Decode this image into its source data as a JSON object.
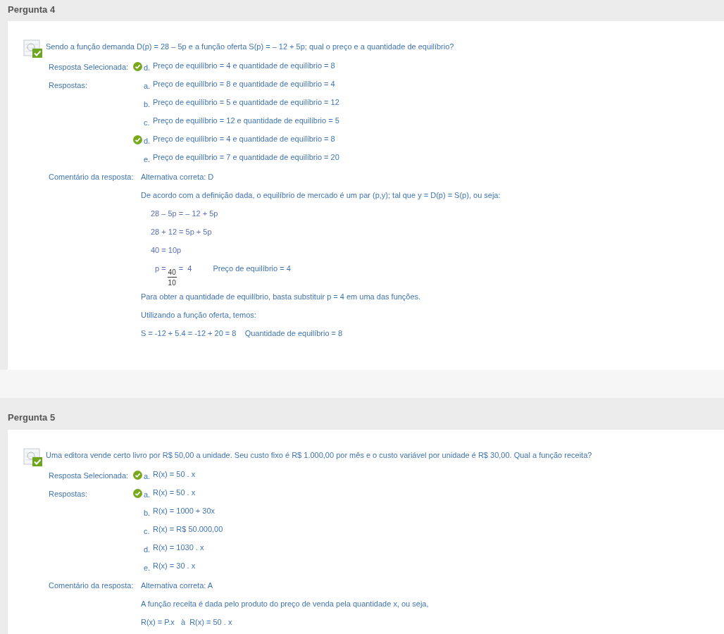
{
  "questions": [
    {
      "title": "Pergunta 4",
      "question": "Sendo a função demanda D(p) = 28 – 5p e a função oferta S(p) = – 12 + 5p; qual o preço e a quantidade de equilíbrio?",
      "correct": true,
      "selected_label": "Resposta Selecionada:",
      "selected_answer": {
        "letter": "d.",
        "text": "Preço de equilíbrio = 4 e quantidade de equilíbrio = 8",
        "correct": true
      },
      "answers_label": "Respostas:",
      "answers": [
        {
          "letter": "a.",
          "text": "Preço de equilíbrio = 8 e quantidade de equilíbrio = 4",
          "correct": false
        },
        {
          "letter": "b.",
          "text": "Preço de equilíbrio = 5 e quantidade de equilíbrio = 12",
          "correct": false
        },
        {
          "letter": "c.",
          "text": "Preço de equilíbrio = 12 e quantidade de equilíbrio = 5",
          "correct": false
        },
        {
          "letter": "d.",
          "text": "Preço de equilíbrio = 4 e quantidade de equilíbrio = 8",
          "correct": true
        },
        {
          "letter": "e.",
          "text": "Preço de equilíbrio = 7 e quantidade de equilíbrio = 20",
          "correct": false
        }
      ],
      "comment_label": "Comentário da resposta:",
      "comment": [
        {
          "kind": "text",
          "text": "Alternativa correta: D"
        },
        {
          "kind": "text",
          "text": "De acordo com a definição dada, o equilíbrio de mercado é um par (p,y); tal que y = D(p) = S(p), ou seja:"
        },
        {
          "kind": "equation",
          "text": "28 – 5p = – 12 + 5p"
        },
        {
          "kind": "equation",
          "text": "28 + 12 = 5p + 5p"
        },
        {
          "kind": "equation",
          "text": "40 = 10p"
        },
        {
          "kind": "fraction",
          "lhs": "p =",
          "numerator": "40",
          "denominator": "10",
          "rhs": "=  4",
          "note": "Preço de equilíbrio = 4"
        },
        {
          "kind": "text",
          "text": "Para obter a quantidade de equilíbrio, basta substituir p = 4 em uma das funções."
        },
        {
          "kind": "text",
          "text": "Utilizando a função oferta, temos:"
        },
        {
          "kind": "text",
          "text": "S = -12 + 5.4 = -12 + 20 = 8    Quantidade de equilíbrio = 8"
        }
      ]
    },
    {
      "title": "Pergunta 5",
      "question": "Uma editora vende certo livro por R$ 50,00 a unidade. Seu custo fixo é R$ 1.000,00 por mês e o custo variável por unidade é R$ 30,00. Qual a função receita?",
      "correct": true,
      "selected_label": "Resposta Selecionada:",
      "selected_answer": {
        "letter": "a.",
        "text": "R(x) = 50 . x",
        "correct": true
      },
      "answers_label": "Respostas:",
      "answers": [
        {
          "letter": "a.",
          "text": "R(x) = 50 . x",
          "correct": true
        },
        {
          "letter": "b.",
          "text": "R(x) = 1000 + 30x",
          "correct": false
        },
        {
          "letter": "c.",
          "text": "R(x) = R$ 50.000,00",
          "correct": false
        },
        {
          "letter": "d.",
          "text": "R(x) = 1030 . x",
          "correct": false
        },
        {
          "letter": "e.",
          "text": "R(x) = 30 . x",
          "correct": false
        }
      ],
      "comment_label": "Comentário da resposta:",
      "comment": [
        {
          "kind": "text",
          "text": "Alternativa correta: A"
        },
        {
          "kind": "text",
          "text": "A função receita é dada pelo produto do preço de venda pela quantidade x, ou seja,"
        },
        {
          "kind": "text",
          "text": "R(x) = P.x   à  R(x) = 50 . x"
        }
      ]
    }
  ]
}
